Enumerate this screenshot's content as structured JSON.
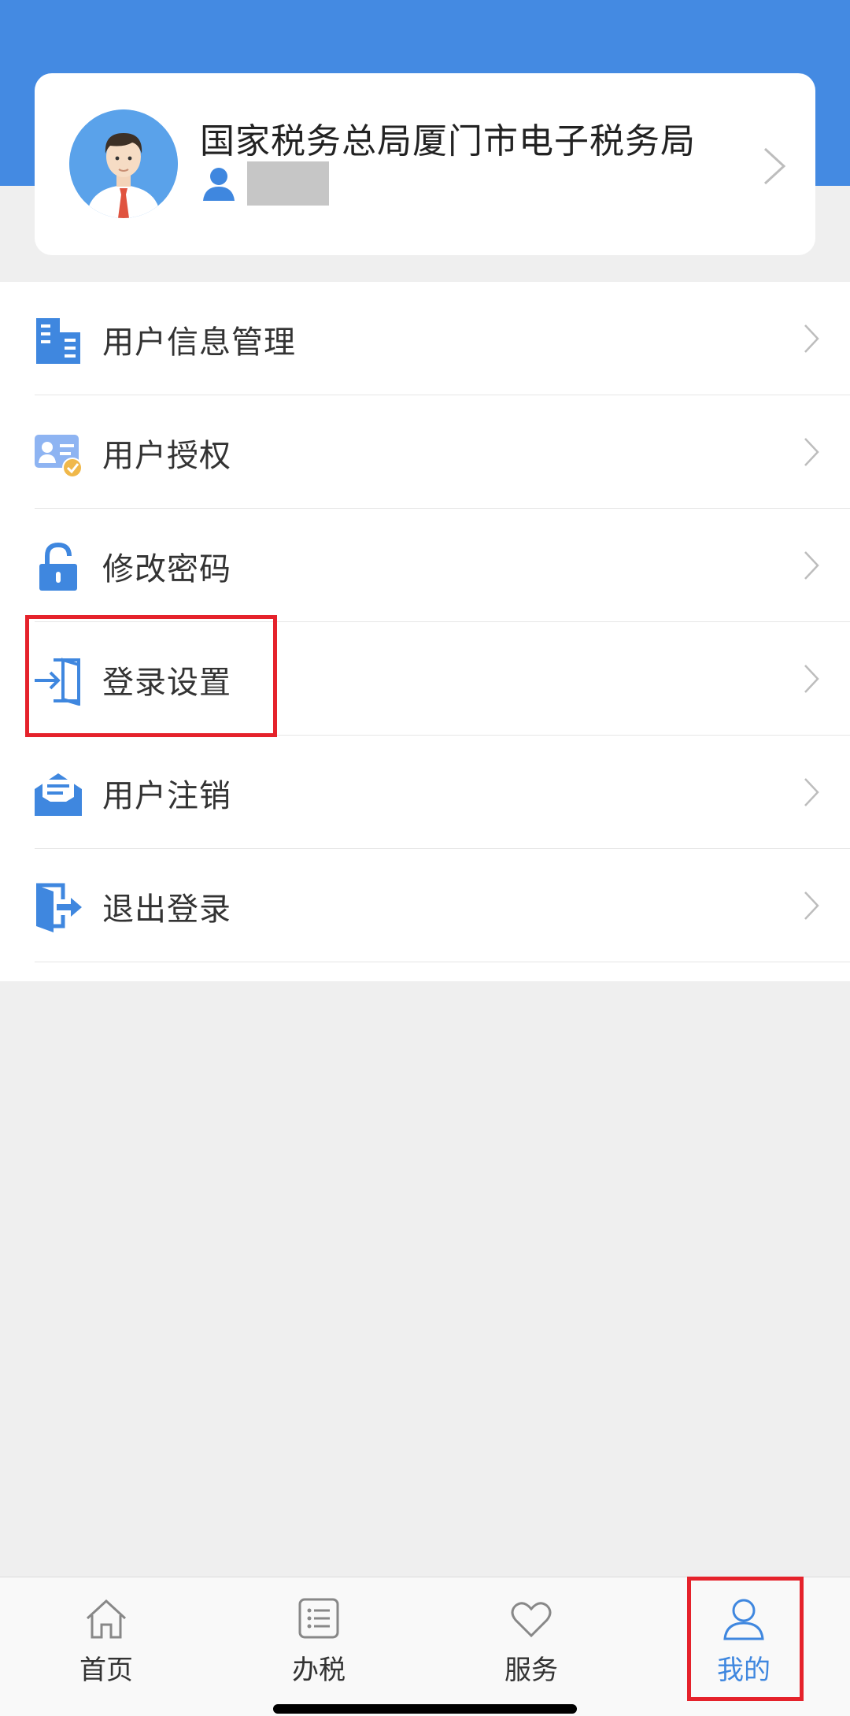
{
  "profile": {
    "agency_name": "国家税务总局厦门市电子税务局",
    "avatar_icon": "user-avatar-icon",
    "user_icon": "person-icon"
  },
  "menu": {
    "items": [
      {
        "label": "用户信息管理",
        "icon": "building-icon"
      },
      {
        "label": "用户授权",
        "icon": "user-card-check-icon"
      },
      {
        "label": "修改密码",
        "icon": "lock-icon"
      },
      {
        "label": "登录设置",
        "icon": "login-door-icon"
      },
      {
        "label": "用户注销",
        "icon": "envelope-icon"
      },
      {
        "label": "退出登录",
        "icon": "logout-icon"
      }
    ]
  },
  "tabbar": {
    "tabs": [
      {
        "label": "首页",
        "icon": "home-icon",
        "active": false
      },
      {
        "label": "办税",
        "icon": "list-icon",
        "active": false
      },
      {
        "label": "服务",
        "icon": "heart-icon",
        "active": false
      },
      {
        "label": "我的",
        "icon": "user-icon",
        "active": true
      }
    ]
  },
  "colors": {
    "header_blue": "#448ae2",
    "icon_blue": "#3f87df",
    "highlight_red": "#e5222b",
    "background": "#efefef"
  }
}
